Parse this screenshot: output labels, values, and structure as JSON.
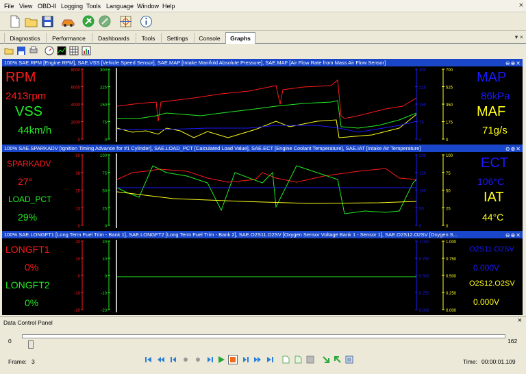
{
  "menu": [
    "File",
    "View",
    "OBD-II",
    "Logging",
    "Tools",
    "Language",
    "Window",
    "Help"
  ],
  "window_close": "×",
  "tabs": [
    "Diagnostics",
    "Performance",
    "Dashboards",
    "Tools",
    "Settings",
    "Console",
    "Graphs"
  ],
  "active_tab": "Graphs",
  "tab_controls": "▾ ×",
  "panels": [
    {
      "header": "100% SAE.RPM [Engine RPM], SAE.VSS [Vehicle Speed Sensor], SAE.MAP [Intake Manifold Absolute Pressure], SAE.MAF [Air Flow Rate from Mass Air Flow Sensor]",
      "header_buttons": "⊖⊕✕",
      "left": [
        {
          "label": "RPM",
          "value": "2413rpm",
          "color": "#ff1a1a"
        },
        {
          "label": "VSS",
          "value": "44km/h",
          "color": "#22ee22"
        }
      ],
      "right": [
        {
          "label": "MAP",
          "value": "86kPa",
          "color": "#1a1aff"
        },
        {
          "label": "MAF",
          "value": "71g/s",
          "color": "#ffff1a"
        }
      ],
      "axis1": [
        "8000",
        "6000",
        "4000",
        "2000",
        "0"
      ],
      "axis2": [
        "300",
        "225",
        "150",
        "75",
        "0"
      ],
      "axis3": [
        "300",
        "225",
        "150",
        "75",
        "0"
      ],
      "axis4": [
        "700",
        "525",
        "350",
        "175",
        "0"
      ]
    },
    {
      "header": "100% SAE.SPARKADV [Ignition Timing Advance for #1 Cylinder], SAE.LOAD_PCT [Calculated Load Value], SAE.ECT [Engine Coolant Temperature], SAE.IAT [Intake Air Temperature]",
      "header_buttons": "⊖⊕✕",
      "left": [
        {
          "label": "SPARKADV",
          "value": "27°",
          "color": "#ff1a1a"
        },
        {
          "label": "LOAD_PCT",
          "value": "29%",
          "color": "#22ee22"
        }
      ],
      "right": [
        {
          "label": "ECT",
          "value": "106°C",
          "color": "#1a1aff"
        },
        {
          "label": "IAT",
          "value": "44°C",
          "color": "#ffff1a"
        }
      ],
      "axis1": [
        "50",
        "38",
        "25",
        "13",
        "0"
      ],
      "axis2": [
        "100",
        "75",
        "50",
        "25",
        "0"
      ],
      "axis3": [
        "200",
        "150",
        "100",
        "50",
        "0"
      ],
      "axis4": [
        "100",
        "75",
        "50",
        "25",
        "0"
      ]
    },
    {
      "header": "100% SAE.LONGFT1 [Long Term Fuel Trim - Bank 1], SAE.LONGFT2 [Long Term Fuel Trim - Bank 2], SAE.O2S11.O2SV [Oxygen Sensor Voltage Bank 1 - Sensor 1], SAE.O2S12.O2SV [Oxygen S...",
      "header_buttons": "⊖⊕✕",
      "left": [
        {
          "label": "LONGFT1",
          "value": "0%",
          "color": "#ff1a1a"
        },
        {
          "label": "LONGFT2",
          "value": "0%",
          "color": "#22ee22"
        }
      ],
      "right": [
        {
          "label": "O2S11.O2SV",
          "value": "0.000V",
          "color": "#1a1aff"
        },
        {
          "label": "O2S12.O2SV",
          "value": "0.000V",
          "color": "#ffff1a"
        }
      ],
      "axis1": [
        "20",
        "10",
        "0",
        "-10",
        "-20"
      ],
      "axis2": [
        "20",
        "10",
        "0",
        "-10",
        "-20"
      ],
      "axis3": [
        "1.000",
        "0.750",
        "0.500",
        "0.250",
        "0.000"
      ],
      "axis4": [
        "1.000",
        "0.750",
        "0.500",
        "0.250",
        "0.000"
      ]
    }
  ],
  "dcp": {
    "title": "Data Control Panel",
    "close": "×",
    "slider_min": "0",
    "slider_max": "162",
    "frame_label": "Frame:",
    "frame": "3",
    "time_label": "Time:",
    "time": "00:00:01.109",
    "position_fraction": 0.0185
  },
  "colors": {
    "red": "#ff1a1a",
    "green": "#22ee22",
    "blue": "#1a1aff",
    "yellow": "#ffff1a",
    "header": "#1a47c9"
  }
}
